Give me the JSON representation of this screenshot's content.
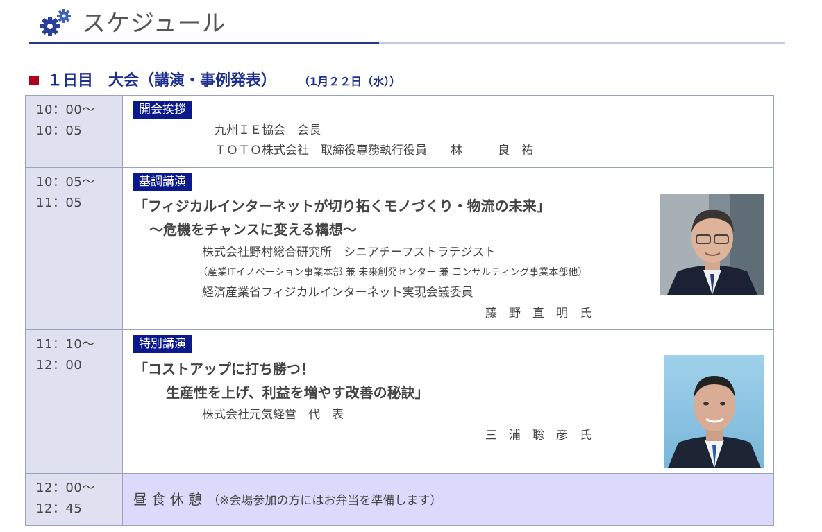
{
  "page": {
    "title": "スケジュール",
    "day_heading": "１日目　大会（講演・事例発表）",
    "day_date": "（1月２２日（水））"
  },
  "rows": [
    {
      "time_start": "10：00～",
      "time_end": "10：05",
      "badge": "開会挨拶",
      "lines": [
        "九州ＩＥ協会　会長",
        "ＴＯＴＯ株式会社　取締役専務執行役員　　林　　　良　祐"
      ]
    },
    {
      "time_start": "10：05～",
      "time_end": "11：05",
      "badge": "基調講演",
      "talk_title": "「フィジカルインターネットが切り拓くモノづくり・物流の未来」",
      "talk_subtitle": "～危機をチャンスに変える構想～",
      "affiliation": "株式会社野村総合研究所　シニアチーフストラテジスト",
      "note": "（産業ITイノベーション事業本部 兼 未来創発センター 兼 コンサルティング事業本部他）",
      "role": "経済産業省フィジカルインターネット実現会議委員",
      "speaker": "藤　野　直　明　氏"
    },
    {
      "time_start": "11：10～",
      "time_end": "12：00",
      "badge": "特別講演",
      "talk_title": "「コストアップに打ち勝つ！",
      "talk_subtitle": "生産性を上げ、利益を増やす改善の秘訣」",
      "affiliation": "株式会社元気経営　代　表",
      "speaker": "三　浦　聡　彦　氏"
    },
    {
      "time_start": "12：00～",
      "time_end": "12：45",
      "label": "昼 食 休 憩",
      "note": "（※会場参加の方にはお弁当を準備します）"
    }
  ],
  "icons": [
    "gear-icon"
  ],
  "colors": {
    "navy": "#0a1a8c",
    "heading_blue": "#1d2f8f",
    "time_bg": "#dfe1f0",
    "lunch_bg": "#dcd9fb",
    "bullet_red": "#b00020"
  }
}
